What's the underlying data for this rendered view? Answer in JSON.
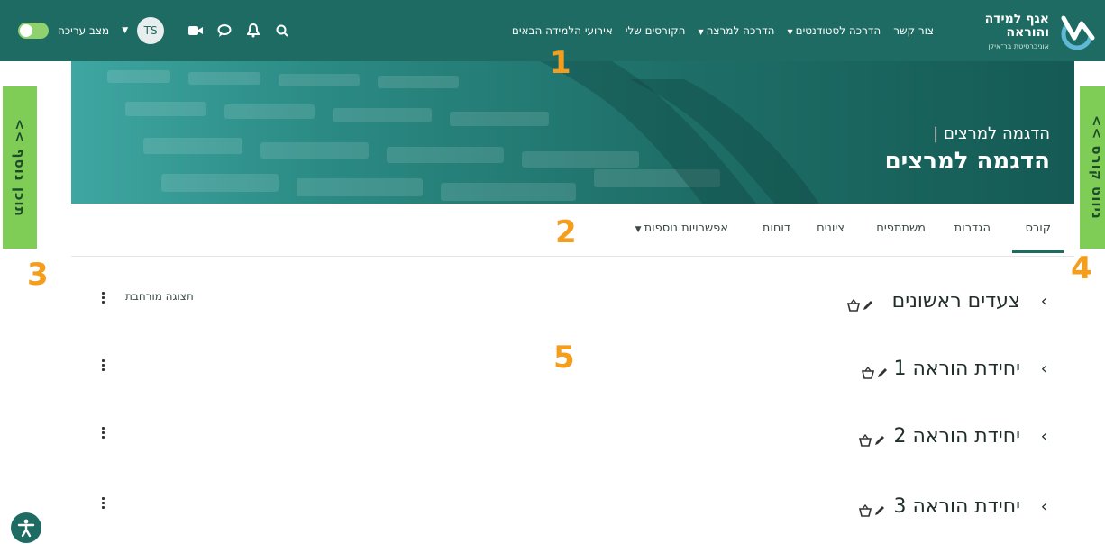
{
  "brand": {
    "line1": "אגף למידה",
    "line2": "והוראה",
    "line3": "אוניברסיטת בר־אילן",
    "color": "#1d6b62"
  },
  "nav": {
    "links": [
      {
        "label": "אירועי הלמידה הבאים",
        "dropdown": false
      },
      {
        "label": "הקורסים שלי",
        "dropdown": false
      },
      {
        "label": "הדרכה למרצה",
        "dropdown": true
      },
      {
        "label": "הדרכה לסטודנטים",
        "dropdown": true
      },
      {
        "label": "צור קשר",
        "dropdown": false
      }
    ],
    "edit_mode_label": "מצב עריכה",
    "avatar_initials": "TS",
    "icons": [
      "search-icon",
      "bell-icon",
      "chat-icon",
      "video-icon"
    ]
  },
  "side_tabs": {
    "left": "תוכן נוסף >>",
    "right": "ניווט קורס >>"
  },
  "banner": {
    "subtitle": "הדגמה למרצים |",
    "title": "הדגמה למרצים"
  },
  "tabs": [
    {
      "label": "קורס",
      "active": true
    },
    {
      "label": "הגדרות",
      "active": false
    },
    {
      "label": "משתתפים",
      "active": false
    },
    {
      "label": "ציונים",
      "active": false
    },
    {
      "label": "דוחות",
      "active": false
    },
    {
      "label": "אפשרויות נוספות",
      "active": false,
      "dropdown": true
    }
  ],
  "annotations": [
    "1",
    "2",
    "3",
    "4",
    "5"
  ],
  "expanded_view_label": "תצוגה מורחבת",
  "sections": [
    {
      "title": "צעדים ראשונים"
    },
    {
      "title": "יחידת הוראה 1"
    },
    {
      "title": "יחידת הוראה 2"
    },
    {
      "title": "יחידת הוראה 3"
    }
  ],
  "colors": {
    "primary": "#1d6b62",
    "side_tab": "#7fcc57",
    "annotation": "#f59d1d"
  }
}
